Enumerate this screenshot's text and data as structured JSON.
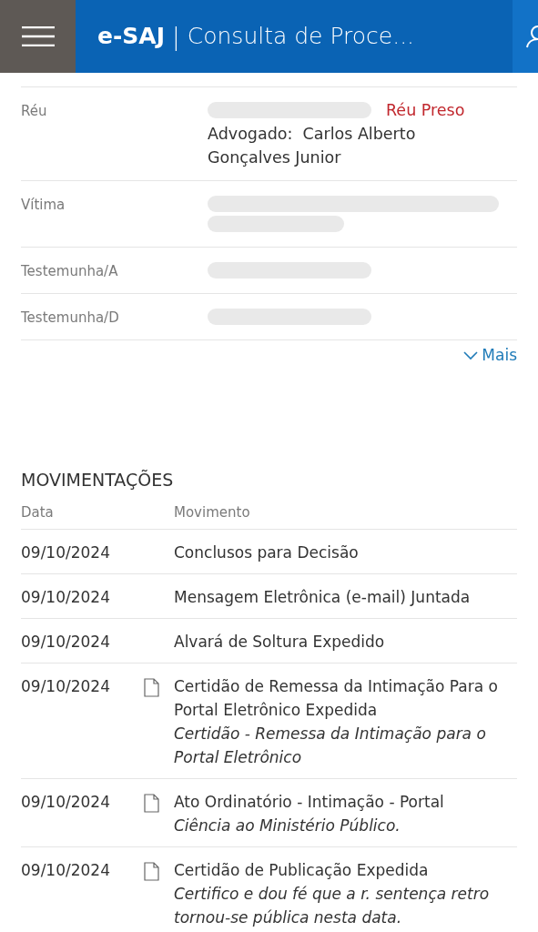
{
  "header": {
    "logo": "e-SAJ",
    "separator": "|",
    "title": "Consulta de Proce..."
  },
  "parties": [
    {
      "role": "Réu",
      "kind": "short",
      "redacted": true,
      "tag": "Réu Preso",
      "lawyer_label": "Advogado:",
      "lawyer": "Carlos Alberto Gonçalves Junior"
    },
    {
      "role": "Vítima",
      "kind": "long",
      "redacted": true
    },
    {
      "role": "Testemunha/A",
      "kind": "short",
      "redacted": true
    },
    {
      "role": "Testemunha/D",
      "kind": "short",
      "redacted": true
    }
  ],
  "more_link": "Mais",
  "movements": {
    "title": "MOVIMENTAÇÕES",
    "columns": [
      "Data",
      "Movimento"
    ],
    "rows": [
      {
        "date": "09/10/2024",
        "document": false,
        "text": "Conclusos para Decisão"
      },
      {
        "date": "09/10/2024",
        "document": false,
        "text": "Mensagem Eletrônica (e-mail) Juntada"
      },
      {
        "date": "09/10/2024",
        "document": false,
        "text": "Alvará de Soltura Expedido"
      },
      {
        "date": "09/10/2024",
        "document": true,
        "text": "Certidão de Remessa da Intimação Para o Portal Eletrônico Expedida",
        "detail": "Certidão - Remessa da Intimação para o Portal Eletrônico"
      },
      {
        "date": "09/10/2024",
        "document": true,
        "text": "Ato Ordinatório - Intimação - Portal",
        "detail": "Ciência ao Ministério Público."
      },
      {
        "date": "09/10/2024",
        "document": true,
        "text": "Certidão de Publicação Expedida",
        "detail": "Certifico e dou fé que a r. sentença retro tornou-se pública nesta data."
      }
    ]
  }
}
